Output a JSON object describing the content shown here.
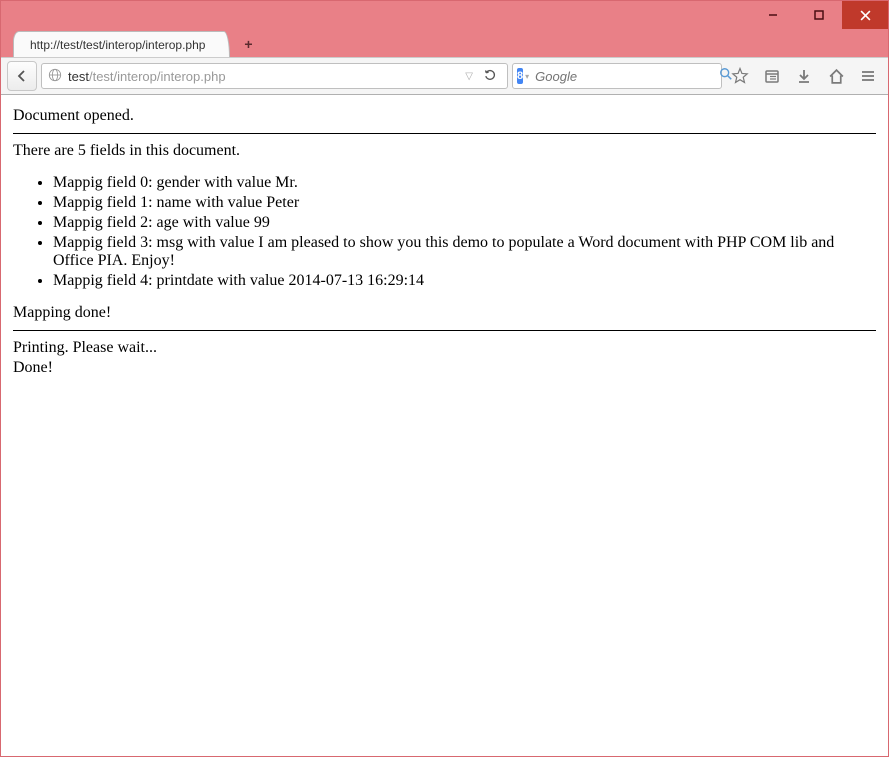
{
  "window": {
    "tab_title": "http://test/test/interop/interop.php"
  },
  "urlbar": {
    "host": "test",
    "path": "/test/interop/interop.php"
  },
  "search": {
    "engine_letter": "8",
    "placeholder": "Google"
  },
  "page": {
    "opened": "Document opened.",
    "summary": "There are 5 fields in this document.",
    "fields": [
      "Mappig field 0: gender with value Mr.",
      "Mappig field 1: name with value Peter",
      "Mappig field 2: age with value 99",
      "Mappig field 3: msg with value I am pleased to show you this demo to populate a Word document with PHP COM lib and Office PIA. Enjoy!",
      "Mappig field 4: printdate with value 2014-07-13 16:29:14"
    ],
    "mapping_done": "Mapping done!",
    "printing": "Printing. Please wait...",
    "done": "Done!"
  }
}
